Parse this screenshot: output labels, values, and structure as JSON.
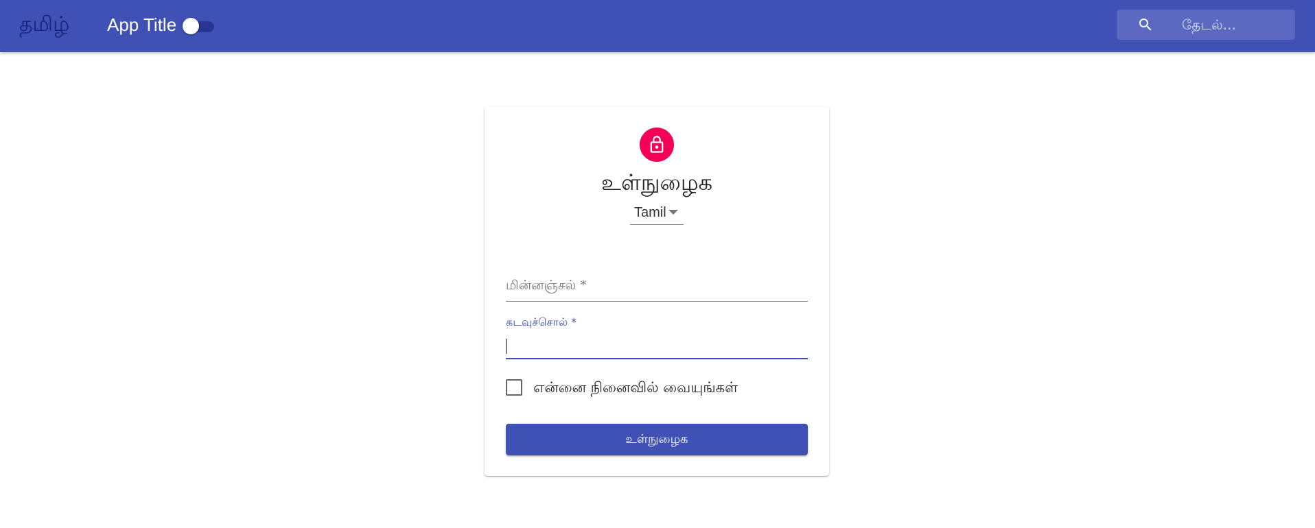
{
  "appbar": {
    "brand": "தமிழ்",
    "title": "App Title",
    "theme_toggle": {
      "checked": false
    },
    "search": {
      "placeholder": "தேடல்...",
      "icon": "search-icon"
    }
  },
  "colors": {
    "primary": "#3f51b5",
    "secondary": "#f50057",
    "brand_text": "#1a237e"
  },
  "login": {
    "icon": "lock-icon",
    "title": "உள்நுழைக",
    "language": {
      "selected": "Tamil"
    },
    "email": {
      "label": "மின்னஞ்சல் *",
      "value": ""
    },
    "password": {
      "label": "கடவுச்சொல் *",
      "value": ""
    },
    "remember_me": {
      "label": "என்னை நினைவில் வையுங்கள்",
      "checked": false
    },
    "submit_label": "உள்நுழைக"
  }
}
